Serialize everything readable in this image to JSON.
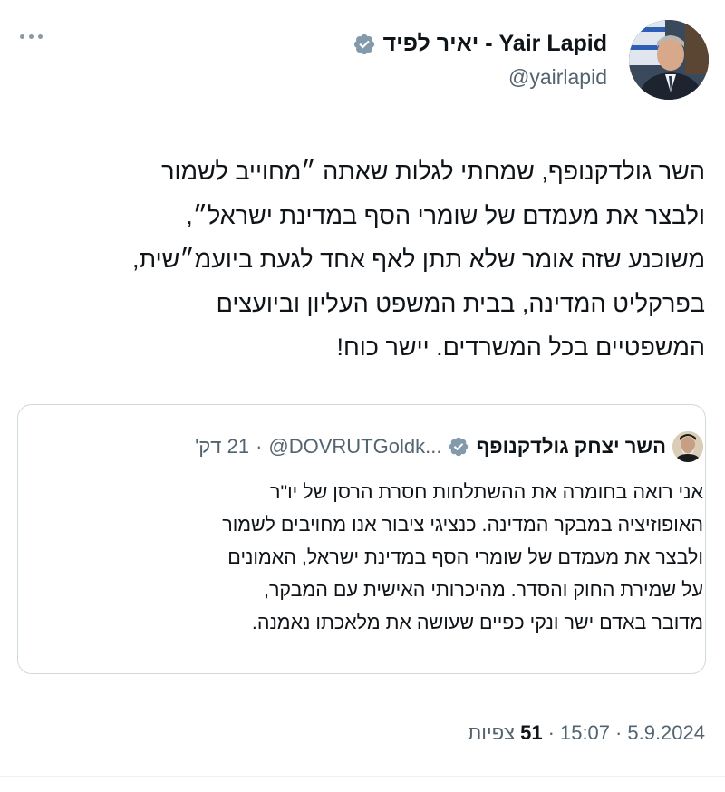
{
  "tweet": {
    "author_name": "יאיר לפיד - Yair Lapid",
    "handle": "@yairlapid",
    "verified_badge_icon": "verified-badge-icon",
    "more_icon": "more-options-icon",
    "text_lines": [
      "השר גולדקנופף, שמחתי לגלות שאתה ״מחוייב לשמור",
      "ולבצר את מעמדם של שומרי הסף במדינת ישראל״,",
      "משוכנע שזה אומר שלא תתן לאף אחד לגעת ביועמ״שית,",
      "בפרקליט המדינה, בבית המשפט העליון וביועצים",
      "המשפטיים בכל המשרדים. יישר כוח!"
    ],
    "date": "5.9.2024",
    "time": "15:07",
    "views_count": "51",
    "views_label": "צפיות",
    "meta_separator": "·"
  },
  "quoted_tweet": {
    "author_name": "השר יצחק גולדקנופף",
    "handle": "@DOVRUTGoldk...",
    "separator": "·",
    "relative_time": "21 דק'",
    "text_lines": [
      "אני רואה בחומרה את ההשתלחות חסרת הרסן של יו\"ר",
      "האופוזיציה במבקר המדינה. כנציגי ציבור אנו מחויבים לשמור",
      "ולבצר את מעמדם של שומרי הסף במדינת ישראל, האמונים",
      "על שמירת החוק והסדר. מהיכרותי האישית עם המבקר,",
      "מדובר באדם ישר ונקי כפיים שעושה את מלאכתו נאמנה."
    ]
  },
  "colors": {
    "text_primary": "#0f1419",
    "text_secondary": "#536471",
    "verified_badge": "#829aab",
    "border": "#cfd9de"
  }
}
